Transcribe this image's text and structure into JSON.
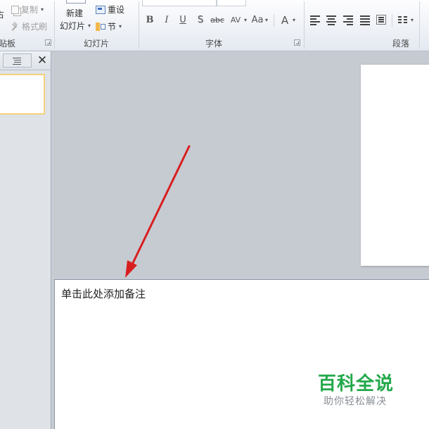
{
  "ribbon": {
    "clipboard": {
      "copy_label": "复制",
      "format_painter_label": "格式刷",
      "group_label": "剪贴板",
      "partial_group_label": "贴板",
      "partial_paste_label": "占"
    },
    "slides": {
      "new_slide_line1": "新建",
      "new_slide_line2": "幻灯片",
      "reset_label": "重设",
      "section_label": "节",
      "group_label": "幻灯片"
    },
    "font": {
      "group_label": "字体",
      "bold": "B",
      "italic": "I",
      "underline": "U",
      "shadow": "S",
      "strike": "abc",
      "spacing": "AV",
      "change_case": "Aa",
      "clear": "A"
    },
    "paragraph": {
      "group_label": "段落"
    }
  },
  "notes": {
    "placeholder": "单击此处添加备注"
  },
  "watermark": {
    "title": "百科全说",
    "subtitle": "助你轻松解决"
  },
  "colors": {
    "arrow": "#d81f1f",
    "watermark_green": "#22a84a",
    "thumbnail_border": "#f3d27a"
  }
}
